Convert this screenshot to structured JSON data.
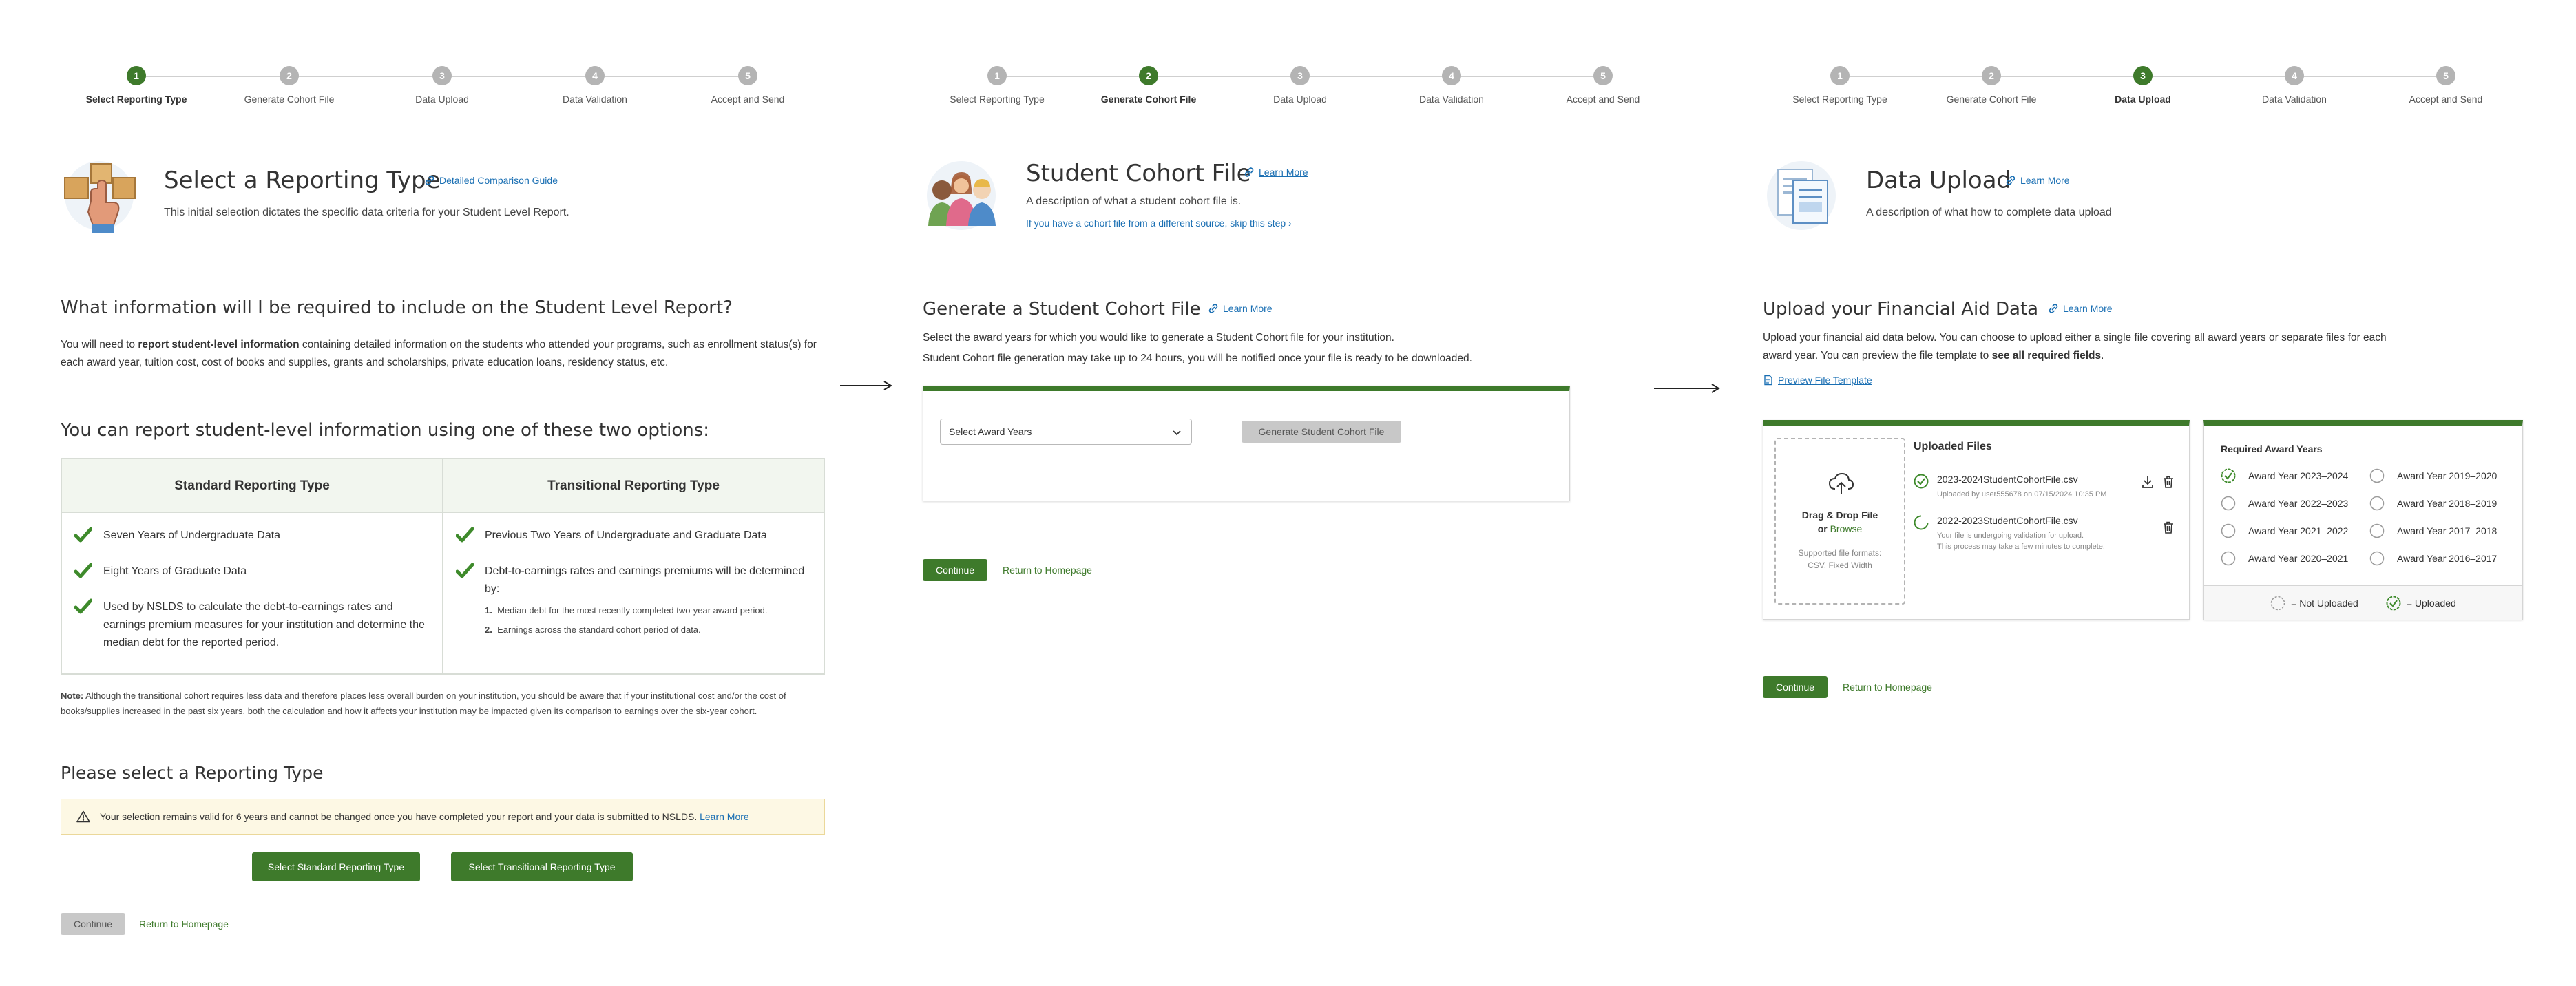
{
  "panel1": {
    "stepper": {
      "steps": [
        {
          "num": "1",
          "label": "Select Reporting Type"
        },
        {
          "num": "2",
          "label": "Generate Cohort File"
        },
        {
          "num": "3",
          "label": "Data Upload"
        },
        {
          "num": "4",
          "label": "Data Validation"
        },
        {
          "num": "5",
          "label": "Accept and Send"
        }
      ],
      "active": 1
    },
    "header": {
      "title": "Select a Reporting Type",
      "link": "Detailed Comparison Guide",
      "description": "This initial selection dictates the specific data criteria for your Student Level Report."
    },
    "info": {
      "title": "What information will I be required to include on the Student Level Report?",
      "para_pre": "You will need to ",
      "para_bold": "report student-level information",
      "para_post": " containing detailed information on the students who attended your programs, such as enrollment status(s) for each award year, tuition cost, cost of books and supplies, grants and scholarships, private education loans, residency status, etc."
    },
    "options_title": "You can report student-level information using one of these two options:",
    "table": {
      "standard": {
        "heading": "Standard Reporting Type",
        "items": [
          "Seven Years of Undergraduate Data",
          "Eight Years of Graduate Data",
          "Used by NSLDS to calculate the debt-to-earnings rates and earnings premium measures for your institution and determine the median debt for the reported period."
        ]
      },
      "transitional": {
        "heading": "Transitional Reporting Type",
        "items": [
          "Previous Two Years of Undergraduate and Graduate Data",
          "Debt-to-earnings rates and earnings premiums will be determined by:"
        ],
        "subitems": [
          "Median debt for the most recently completed two-year award period.",
          "Earnings across the standard cohort period of data."
        ]
      }
    },
    "note_label": "Note:",
    "note_text": " Although the transitional cohort requires less data and therefore places less overall burden on your institution, you should be aware that if your institutional cost and/or the cost of books/supplies increased in the past six years, both the calculation and how it affects your institution may be impacted given its comparison to earnings over the six-year cohort.",
    "select_title": "Please select a Reporting Type",
    "alert": {
      "text": "Your selection remains valid for 6 years and cannot be changed once you have completed your report and your data is submitted to NSLDS.",
      "link": "Learn More"
    },
    "buttons": {
      "standard": "Select Standard Reporting Type",
      "transitional": "Select Transitional Reporting Type",
      "continue": "Continue",
      "return": "Return to Homepage"
    }
  },
  "panel2": {
    "stepper": {
      "steps": [
        {
          "num": "1",
          "label": "Select Reporting Type"
        },
        {
          "num": "2",
          "label": "Generate Cohort File"
        },
        {
          "num": "3",
          "label": "Data Upload"
        },
        {
          "num": "4",
          "label": "Data Validation"
        },
        {
          "num": "5",
          "label": "Accept and Send"
        }
      ],
      "active": 2
    },
    "header": {
      "title": "Student Cohort File",
      "link": "Learn More",
      "description": "A description of what a student cohort file is.",
      "skip_link": "If you have a cohort file from a different source, skip this step"
    },
    "section": {
      "title": "Generate a Student Cohort File",
      "link": "Learn More",
      "line1": "Select the award years for which you would like to generate a Student Cohort file for your institution.",
      "line2": "Student Cohort file generation may take up to 24 hours, you will be notified once your file is ready to be downloaded."
    },
    "select_placeholder": "Select Award Years",
    "generate_button": "Generate Student Cohort File",
    "buttons": {
      "continue": "Continue",
      "return": "Return to Homepage"
    }
  },
  "panel3": {
    "stepper": {
      "steps": [
        {
          "num": "1",
          "label": "Select Reporting Type"
        },
        {
          "num": "2",
          "label": "Generate Cohort File"
        },
        {
          "num": "3",
          "label": "Data Upload"
        },
        {
          "num": "4",
          "label": "Data Validation"
        },
        {
          "num": "5",
          "label": "Accept and Send"
        }
      ],
      "active": 3
    },
    "header": {
      "title": "Data Upload",
      "link": "Learn More",
      "description": "A description of what how to complete data upload"
    },
    "section": {
      "title": "Upload your Financial Aid Data",
      "link": "Learn More",
      "para_pre": "Upload your financial aid data below. You can choose to upload either a single file covering all award years or separate files for each award year. You can preview the file template to ",
      "para_bold": "see all required fields",
      "para_post": ".",
      "preview_link": "Preview File Template"
    },
    "dropzone": {
      "title_line1": "Drag & Drop File",
      "title_or": "or ",
      "browse": "Browse",
      "sub_line1": "Supported file formats:",
      "sub_line2": "CSV, Fixed Width"
    },
    "uploaded_title": "Uploaded Files",
    "files": [
      {
        "name": "2023-2024StudentCohortFile.csv",
        "meta1": "Uploaded by user555678 on 07/15/2024 10:35 PM",
        "meta2": "",
        "status": "uploaded"
      },
      {
        "name": "2022-2023StudentCohortFile.csv",
        "meta1": "Your file is undergoing validation for upload.",
        "meta2": "This process may take a few minutes to complete.",
        "status": "validating"
      }
    ],
    "years_title": "Required Award Years",
    "years": [
      {
        "label": "Award Year 2023–2024",
        "uploaded": true
      },
      {
        "label": "Award Year 2022–2023",
        "uploaded": false
      },
      {
        "label": "Award Year 2021–2022",
        "uploaded": false
      },
      {
        "label": "Award Year 2020–2021",
        "uploaded": false
      },
      {
        "label": "Award Year 2019–2020",
        "uploaded": false
      },
      {
        "label": "Award Year 2018–2019",
        "uploaded": false
      },
      {
        "label": "Award Year 2017–2018",
        "uploaded": false
      },
      {
        "label": "Award Year 2016–2017",
        "uploaded": false
      }
    ],
    "legend": {
      "not_uploaded": "= Not Uploaded",
      "uploaded": "= Uploaded"
    },
    "buttons": {
      "continue": "Continue",
      "return": "Return to Homepage"
    }
  },
  "colors": {
    "accent": "#3e7a2b",
    "link": "#1a6fb3",
    "alert_bg": "#fdf8e4"
  },
  "icons": [
    "link-icon",
    "check-icon",
    "warning-icon",
    "arrow-right-icon",
    "chevron-down-icon",
    "cloud-upload-icon",
    "download-icon",
    "trash-icon",
    "document-icon"
  ]
}
